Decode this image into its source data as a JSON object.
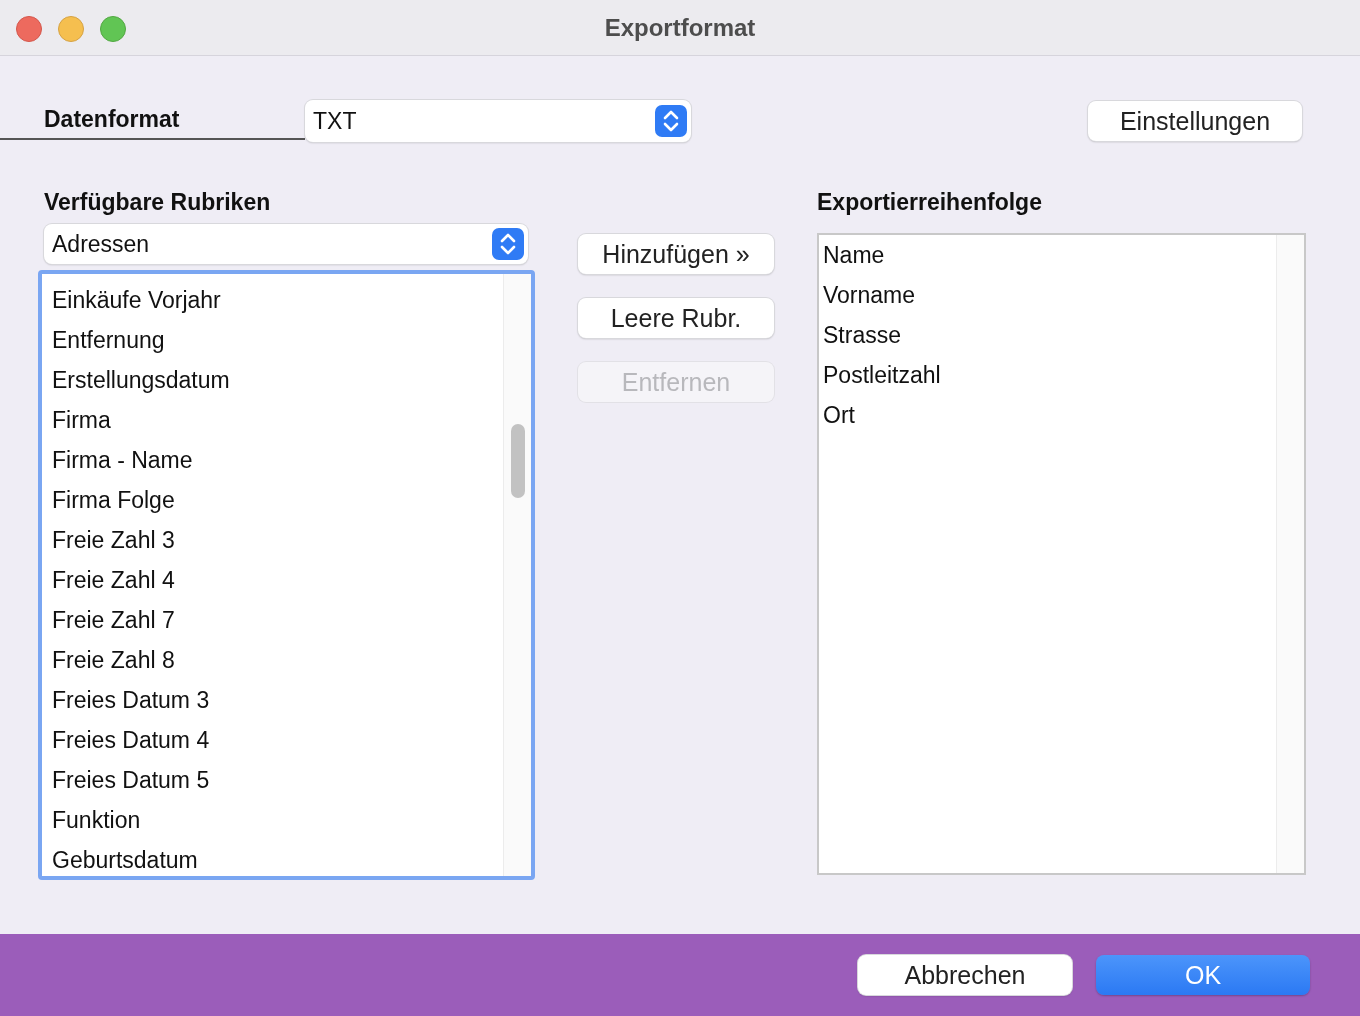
{
  "window": {
    "title": "Exportformat"
  },
  "data_format": {
    "label": "Datenformat",
    "value": "TXT"
  },
  "settings_button": {
    "label": "Einstellungen"
  },
  "available": {
    "heading": "Verfügbare Rubriken",
    "category": "Adressen",
    "focused": true,
    "items": [
      "Einkäufe Vorjahr",
      "Entfernung",
      "Erstellungsdatum",
      "Firma",
      "Firma - Name",
      "Firma Folge",
      "Freie Zahl 3",
      "Freie Zahl 4",
      "Freie Zahl 7",
      "Freie Zahl 8",
      "Freies Datum 3",
      "Freies Datum 4",
      "Freies Datum 5",
      "Funktion",
      "Geburtsdatum"
    ]
  },
  "actions": [
    {
      "label": "Hinzufügen »",
      "disabled": false
    },
    {
      "label": "Leere Rubr.",
      "disabled": false
    },
    {
      "label": "Entfernen",
      "disabled": true
    }
  ],
  "export_order": {
    "heading": "Exportierreihenfolge",
    "items": [
      "Name",
      "Vorname",
      "Strasse",
      "Postleitzahl",
      "Ort"
    ]
  },
  "footer_buttons": [
    {
      "label": "Abbrechen",
      "primary": false
    },
    {
      "label": "OK",
      "primary": true
    }
  ]
}
